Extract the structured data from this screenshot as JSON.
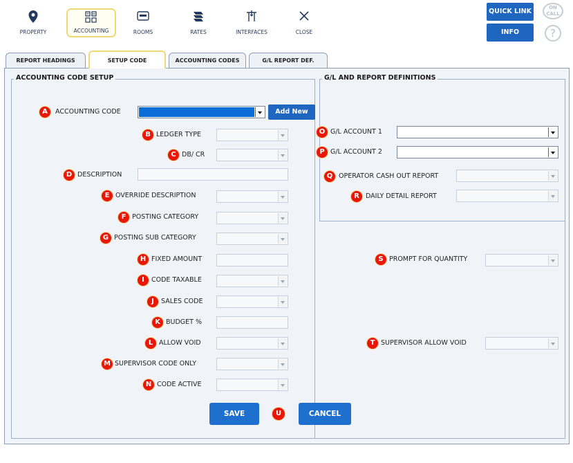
{
  "toolbar": {
    "items": [
      {
        "label": "PROPERTY",
        "icon": "map-pin-icon"
      },
      {
        "label": "ACCOUNTING",
        "icon": "accounting-icon"
      },
      {
        "label": "ROOMS",
        "icon": "room-key-icon"
      },
      {
        "label": "RATES",
        "icon": "rates-icon"
      },
      {
        "label": "INTERFACES",
        "icon": "interfaces-icon"
      },
      {
        "label": "CLOSE",
        "icon": "close-icon"
      }
    ],
    "quick_link_label": "QUICK LINK",
    "info_label": "INFO",
    "on_call_label": "ON CALL",
    "help_label": "?"
  },
  "tabs": [
    "REPORT HEADINGS",
    "SETUP CODE",
    "ACCOUNTING CODES",
    "G/L REPORT DEF."
  ],
  "active_tab": "SETUP CODE",
  "accounting_setup": {
    "title": "ACCOUNTING CODE SETUP",
    "add_new_label": "Add New",
    "fields": [
      {
        "badge": "A",
        "label": "ACCOUNTING CODE"
      },
      {
        "badge": "B",
        "label": "LEDGER TYPE"
      },
      {
        "badge": "C",
        "label": "DB/ CR"
      },
      {
        "badge": "D",
        "label": "DESCRIPTION"
      },
      {
        "badge": "E",
        "label": "OVERRIDE DESCRIPTION"
      },
      {
        "badge": "F",
        "label": "POSTING CATEGORY"
      },
      {
        "badge": "G",
        "label": "POSTING SUB CATEGORY"
      },
      {
        "badge": "H",
        "label": "FIXED AMOUNT"
      },
      {
        "badge": "I",
        "label": "CODE TAXABLE"
      },
      {
        "badge": "J",
        "label": "SALES CODE"
      },
      {
        "badge": "K",
        "label": "BUDGET %"
      },
      {
        "badge": "L",
        "label": "ALLOW VOID"
      },
      {
        "badge": "M",
        "label": "SUPERVISOR CODE ONLY"
      },
      {
        "badge": "N",
        "label": "CODE ACTIVE"
      }
    ]
  },
  "gl_definitions": {
    "title": "G/L AND REPORT DEFINITIONS",
    "fields": [
      {
        "badge": "O",
        "label": "G/L ACCOUNT 1"
      },
      {
        "badge": "P",
        "label": "G/L ACCOUNT 2"
      },
      {
        "badge": "Q",
        "label": "OPERATOR CASH OUT REPORT"
      },
      {
        "badge": "R",
        "label": "DAILY DETAIL REPORT"
      }
    ]
  },
  "extra_fields": [
    {
      "badge": "S",
      "label": "PROMPT FOR QUANTITY"
    },
    {
      "badge": "T",
      "label": "SUPERVISOR ALLOW VOID"
    }
  ],
  "actions": {
    "save_label": "SAVE",
    "cancel_label": "CANCEL",
    "badge": "U"
  },
  "colors": {
    "primary_blue": "#1f66c1",
    "badge_red": "#e8170a",
    "active_tab_border": "#f0d777",
    "panel_bg": "#f0f3f8"
  }
}
